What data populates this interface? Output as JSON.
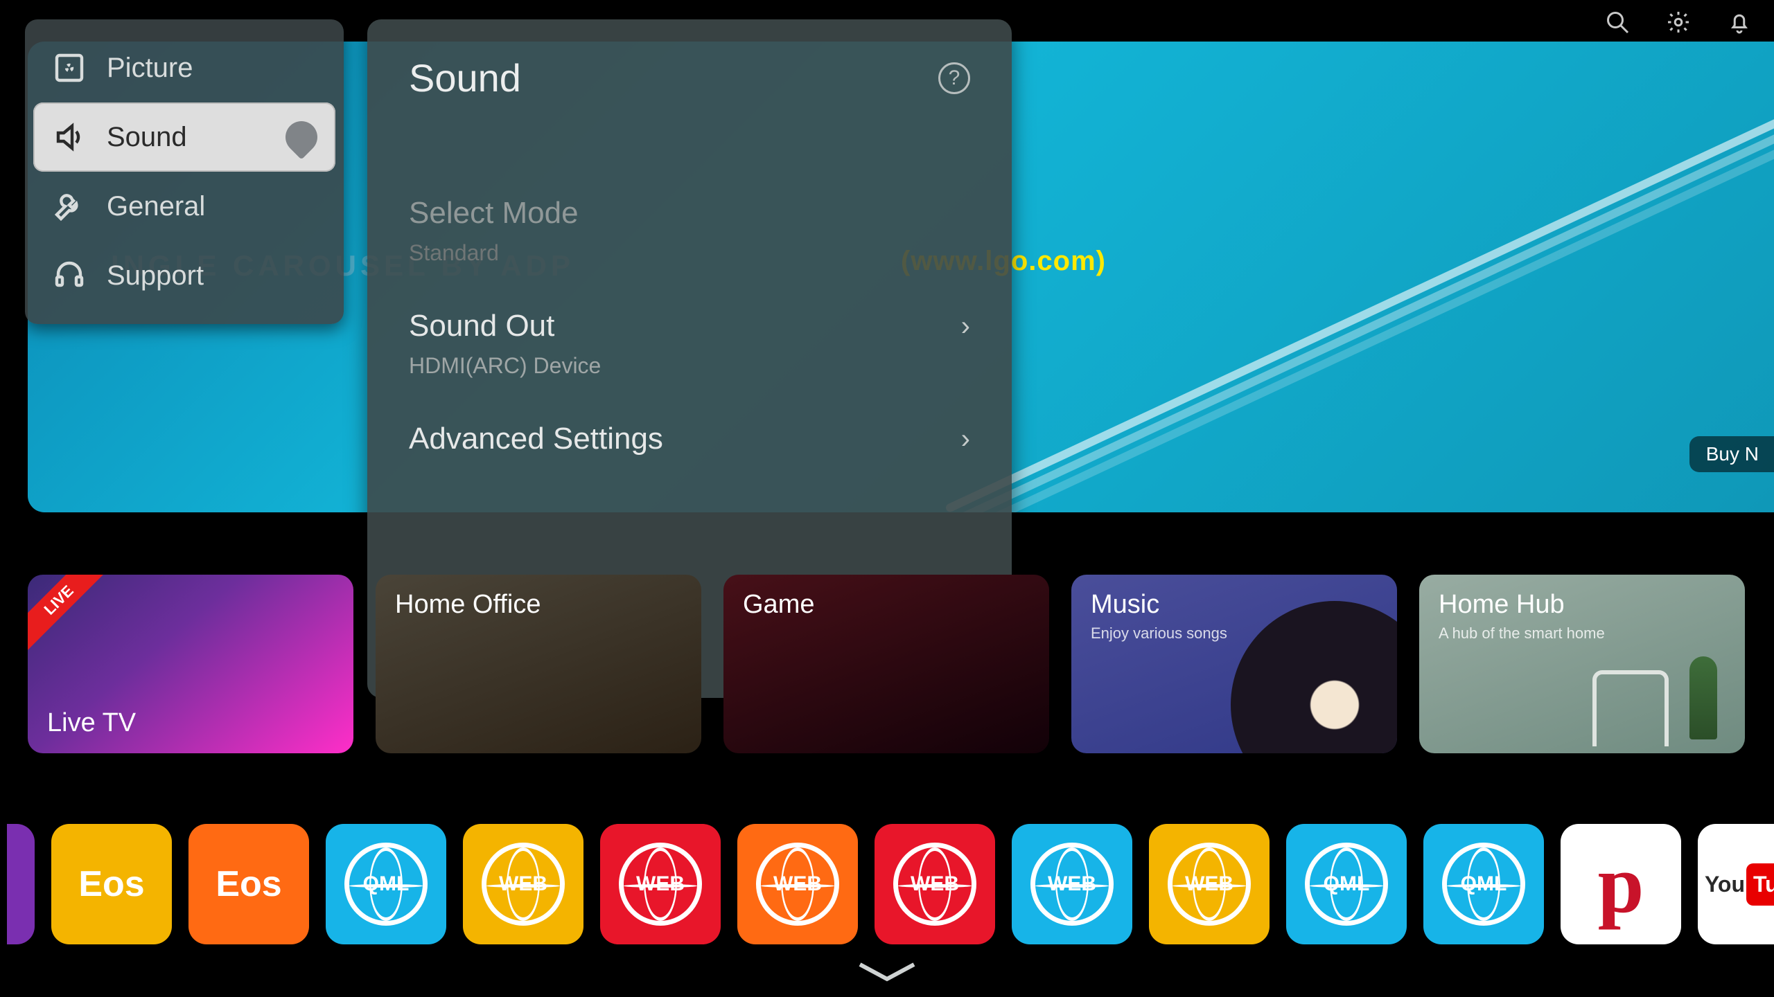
{
  "topbar": {
    "search": "Search",
    "settings": "Settings",
    "notifications": "Notifications"
  },
  "hero_banner": {
    "subtitle": "INGLE CAROUSEL BY ADP",
    "brand_url": "(www.lgo.com)",
    "cta": "Buy N"
  },
  "settings_sidebar": {
    "items": [
      {
        "label": "Picture"
      },
      {
        "label": "Sound"
      },
      {
        "label": "General"
      },
      {
        "label": "Support"
      }
    ],
    "active_index": 1
  },
  "detail_panel": {
    "title": "Sound",
    "help": "?",
    "rows": [
      {
        "label": "Select Mode",
        "sub": "Standard",
        "dim": true,
        "chevron": false
      },
      {
        "label": "Sound Out",
        "sub": "HDMI(ARC) Device",
        "dim": false,
        "chevron": true
      },
      {
        "label": "Advanced Settings",
        "sub": "",
        "dim": false,
        "chevron": true
      }
    ]
  },
  "cards": [
    {
      "title": "Live TV",
      "sub": "",
      "ribbon": "LIVE",
      "variant": "live"
    },
    {
      "title": "Home Office",
      "sub": "",
      "ribbon": "",
      "variant": "office"
    },
    {
      "title": "Game",
      "sub": "",
      "ribbon": "",
      "variant": "game"
    },
    {
      "title": "Music",
      "sub": "Enjoy various songs",
      "ribbon": "",
      "variant": "music"
    },
    {
      "title": "Home Hub",
      "sub": "A hub of the smart home",
      "ribbon": "",
      "variant": "hub"
    }
  ],
  "apps": [
    {
      "label": "",
      "text": "",
      "color": "#7a2fb0",
      "half": true
    },
    {
      "label": "Eos",
      "text": "Eos",
      "color": "#f4b400"
    },
    {
      "label": "Eos",
      "text": "Eos",
      "color": "#ff6a13"
    },
    {
      "label": "QML",
      "text": "QML",
      "color": "#17b4e8",
      "globe": true
    },
    {
      "label": "WEB",
      "text": "WEB",
      "color": "#f4b400",
      "globe": true
    },
    {
      "label": "WEB",
      "text": "WEB",
      "color": "#e8162a",
      "globe": true
    },
    {
      "label": "WEB",
      "text": "WEB",
      "color": "#ff6a13",
      "globe": true
    },
    {
      "label": "WEB",
      "text": "WEB",
      "color": "#e8162a",
      "globe": true
    },
    {
      "label": "WEB",
      "text": "WEB",
      "color": "#17b4e8",
      "globe": true
    },
    {
      "label": "WEB",
      "text": "WEB",
      "color": "#f4b400",
      "globe": true
    },
    {
      "label": "QML",
      "text": "QML",
      "color": "#17b4e8",
      "globe": true
    },
    {
      "label": "QML",
      "text": "QML",
      "color": "#17b4e8",
      "globe": true
    },
    {
      "label": "P",
      "text": "p",
      "variant": "p"
    },
    {
      "label": "YouTube",
      "pre": "You",
      "badge": "Tube",
      "variant": "yt"
    }
  ]
}
